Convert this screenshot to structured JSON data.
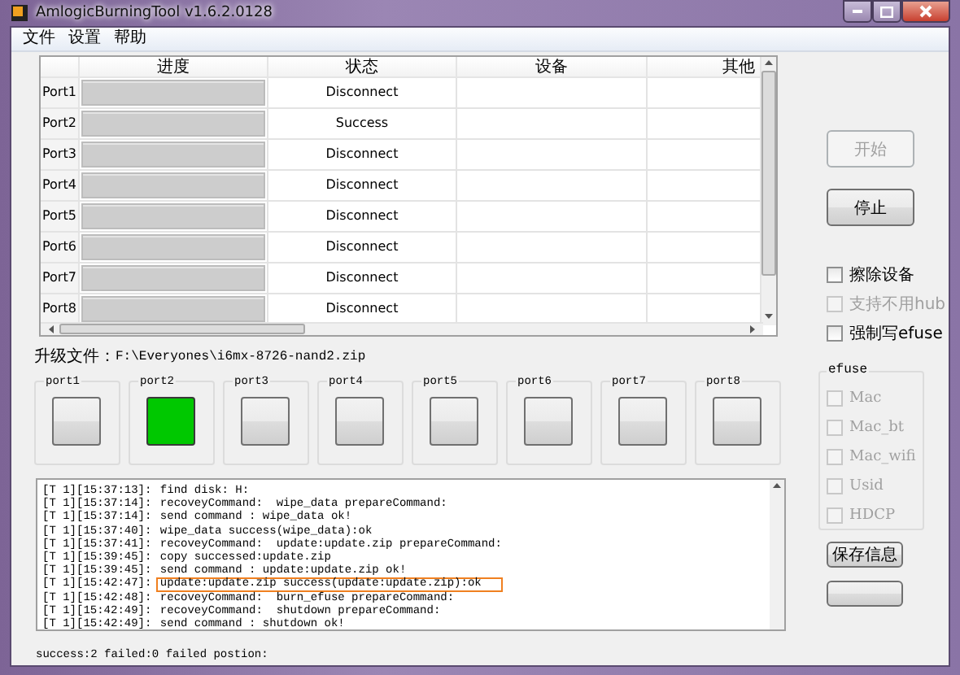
{
  "window": {
    "title": "AmlogicBurningTool  v1.6.2.0128"
  },
  "menu": [
    "文件",
    "设置",
    "帮助"
  ],
  "table": {
    "columns": [
      "进度",
      "状态",
      "设备",
      "其他"
    ],
    "rows": [
      {
        "port": "Port1",
        "status": "Disconnect",
        "level": 0
      },
      {
        "port": "Port2",
        "status": "Success",
        "level": 0
      },
      {
        "port": "Port3",
        "status": "Disconnect",
        "level": 0
      },
      {
        "port": "Port4",
        "status": "Disconnect",
        "level": 0
      },
      {
        "port": "Port5",
        "status": "Disconnect",
        "level": 0
      },
      {
        "port": "Port6",
        "status": "Disconnect",
        "level": 0
      },
      {
        "port": "Port7",
        "status": "Disconnect",
        "level": 0
      },
      {
        "port": "Port8",
        "status": "Disconnect",
        "level": 0
      }
    ]
  },
  "upgrade_file": {
    "label": "升级文件：",
    "path": "F:\\Everyones\\i6mx-8726-nand2.zip"
  },
  "ports": [
    {
      "label": "port1",
      "lit": false
    },
    {
      "label": "port2",
      "lit": true
    },
    {
      "label": "port3",
      "lit": false
    },
    {
      "label": "port4",
      "lit": false
    },
    {
      "label": "port5",
      "lit": false
    },
    {
      "label": "port6",
      "lit": false
    },
    {
      "label": "port7",
      "lit": false
    },
    {
      "label": "port8",
      "lit": false
    }
  ],
  "log": [
    {
      "prefix": "[T 1][15:37:13]:",
      "message": "find disk: H:",
      "highlighted": false
    },
    {
      "prefix": "[T 1][15:37:14]:",
      "message": "recoveyCommand:  wipe_data prepareCommand:",
      "highlighted": false
    },
    {
      "prefix": "[T 1][15:37:14]:",
      "message": "send command : wipe_data ok!",
      "highlighted": false
    },
    {
      "prefix": "[T 1][15:37:40]:",
      "message": "wipe_data success(wipe_data):ok",
      "highlighted": false
    },
    {
      "prefix": "[T 1][15:37:41]:",
      "message": "recoveyCommand:  update:update.zip prepareCommand:",
      "highlighted": false
    },
    {
      "prefix": "[T 1][15:39:45]:",
      "message": "copy successed:update.zip",
      "highlighted": false
    },
    {
      "prefix": "[T 1][15:39:45]:",
      "message": "send command : update:update.zip ok!",
      "highlighted": false
    },
    {
      "prefix": "[T 1][15:42:47]:",
      "message": "update:update.zip success(update:update.zip):ok",
      "highlighted": true
    },
    {
      "prefix": "[T 1][15:42:48]:",
      "message": "recoveyCommand:  burn_efuse prepareCommand:",
      "highlighted": false
    },
    {
      "prefix": "[T 1][15:42:49]:",
      "message": "recoveyCommand:  shutdown prepareCommand:",
      "highlighted": false
    },
    {
      "prefix": "[T 1][15:42:49]:",
      "message": "send command : shutdown ok!",
      "highlighted": false
    }
  ],
  "status_bar": "success:2 failed:0 failed postion:",
  "buttons": [
    {
      "label": "开始",
      "disabled": true
    },
    {
      "label": "停止",
      "disabled": false
    }
  ],
  "options": [
    {
      "label": "擦除设备",
      "checked": false,
      "disabled": false
    },
    {
      "label": "支持不用hub",
      "checked": false,
      "disabled": true
    },
    {
      "label": "强制写efuse",
      "checked": false,
      "disabled": false
    }
  ],
  "efuse": {
    "title": "efuse",
    "options": [
      {
        "label": "Mac",
        "checked": false,
        "disabled": true
      },
      {
        "label": "Mac_bt",
        "checked": false,
        "disabled": true
      },
      {
        "label": "Mac_wifi",
        "checked": false,
        "disabled": true
      },
      {
        "label": "Usid",
        "checked": false,
        "disabled": true
      },
      {
        "label": "HDCP",
        "checked": false,
        "disabled": true
      }
    ]
  },
  "bottom_buttons": [
    "保存信息"
  ]
}
